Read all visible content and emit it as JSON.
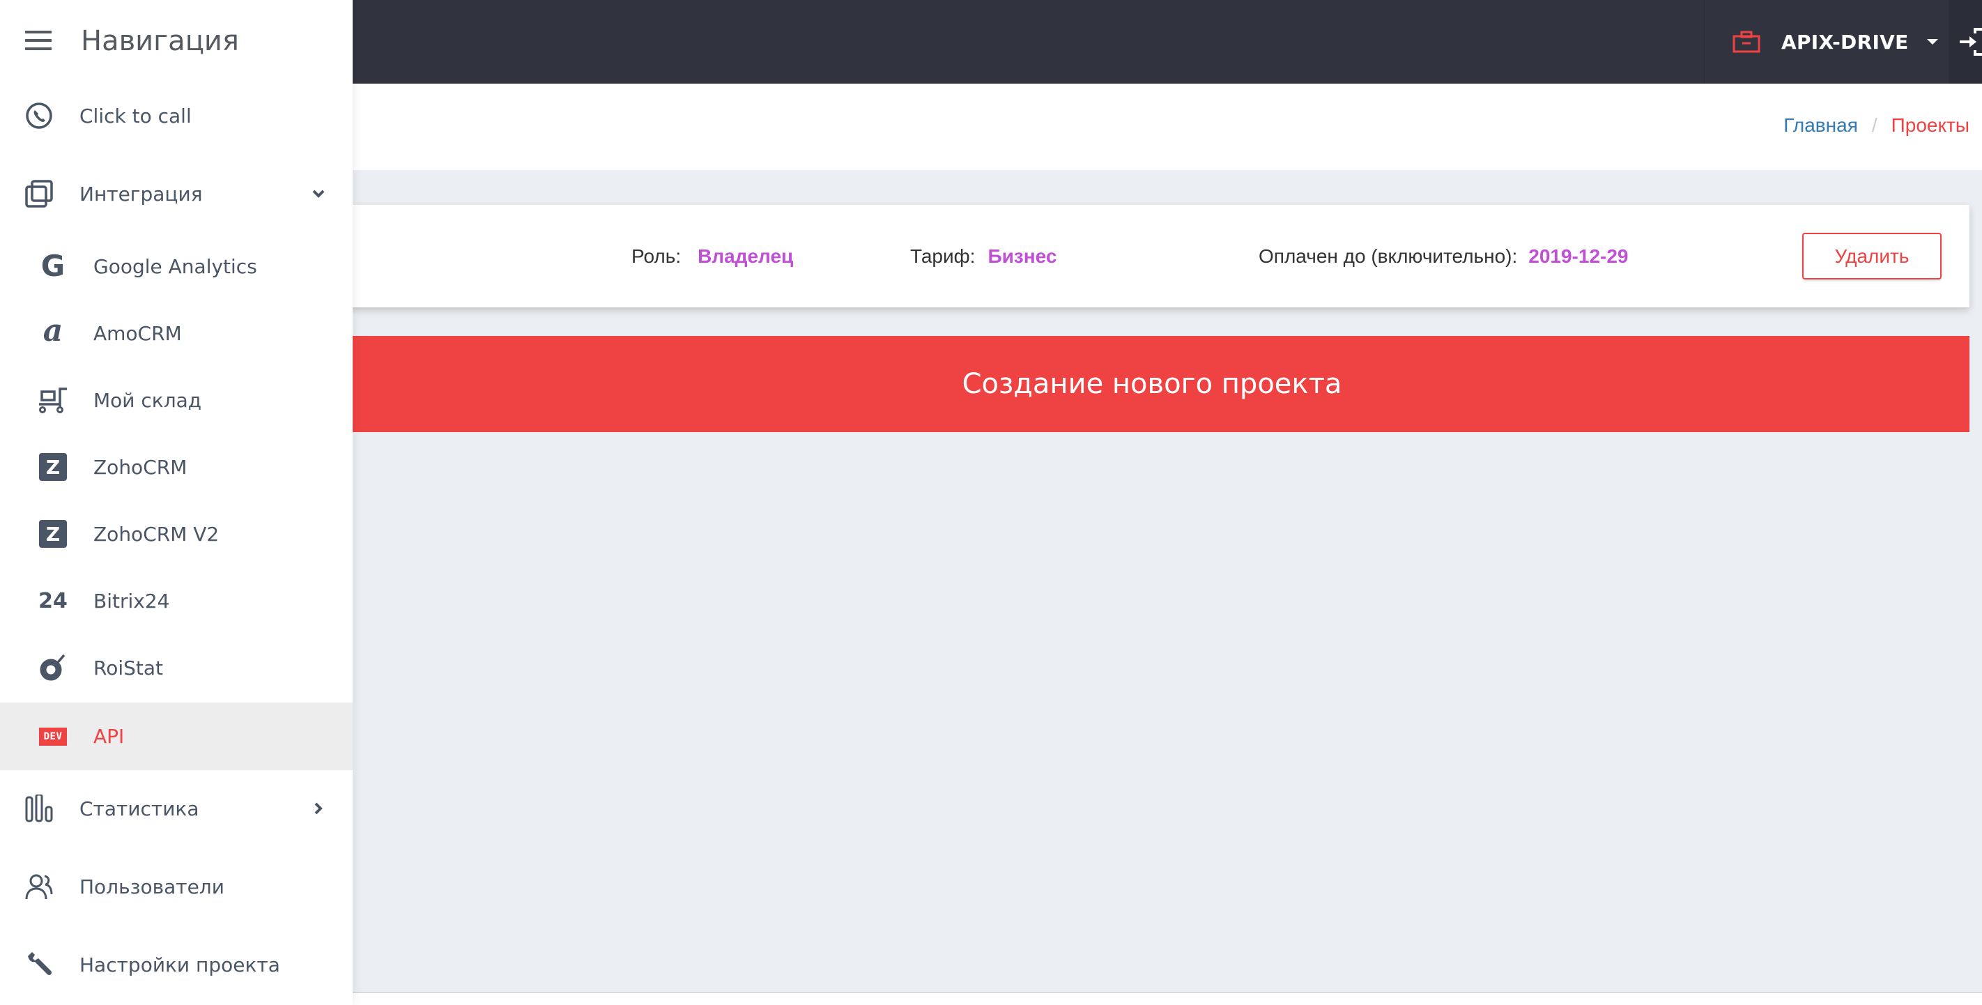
{
  "topbar": {
    "project_name": "APIX-DRIVE",
    "project_icon": "briefcase-icon",
    "logout_icon": "logout-icon"
  },
  "breadcrumb": {
    "home": "Главная",
    "separator": "/",
    "current": "Проекты"
  },
  "project_info": {
    "role_label": "Роль:",
    "role_value": "Владелец",
    "tariff_label": "Тариф:",
    "tariff_value": "Бизнес",
    "paid_label": "Оплачен до (включительно):",
    "paid_value": "2019-12-29",
    "delete_button": "Удалить"
  },
  "create_project": {
    "label": "Создание нового проекта"
  },
  "sidebar": {
    "title": "Навигация",
    "items": [
      {
        "label": "Click to call",
        "icon": "phone-icon"
      },
      {
        "label": "Интеграция",
        "icon": "integration-icon",
        "expanded": true
      },
      {
        "label": "Google Analytics",
        "icon": "google-icon",
        "glyph": "G"
      },
      {
        "label": "AmoCRM",
        "icon": "amocrm-icon",
        "glyph": "a"
      },
      {
        "label": "Мой склад",
        "icon": "moysklad-icon"
      },
      {
        "label": "ZohoCRM",
        "icon": "zoho-icon",
        "glyph": "Z"
      },
      {
        "label": "ZohoCRM V2",
        "icon": "zoho-icon",
        "glyph": "Z"
      },
      {
        "label": "Bitrix24",
        "icon": "bitrix24-icon",
        "glyph": "24"
      },
      {
        "label": "RoiStat",
        "icon": "roistat-icon"
      },
      {
        "label": "API",
        "icon": "dev-icon",
        "glyph": "DEV",
        "active": true
      },
      {
        "label": "Статистика",
        "icon": "statistics-icon",
        "expanded": false
      },
      {
        "label": "Пользователи",
        "icon": "users-icon"
      },
      {
        "label": "Настройки проекта",
        "icon": "wrench-icon"
      }
    ]
  },
  "colors": {
    "accent": "#ef4343",
    "value_purple": "#c04fd6",
    "topbar": "#31333f",
    "link_blue": "#337ab7",
    "sidebar_text": "#4a5566",
    "page_bg": "#ebeef3"
  }
}
